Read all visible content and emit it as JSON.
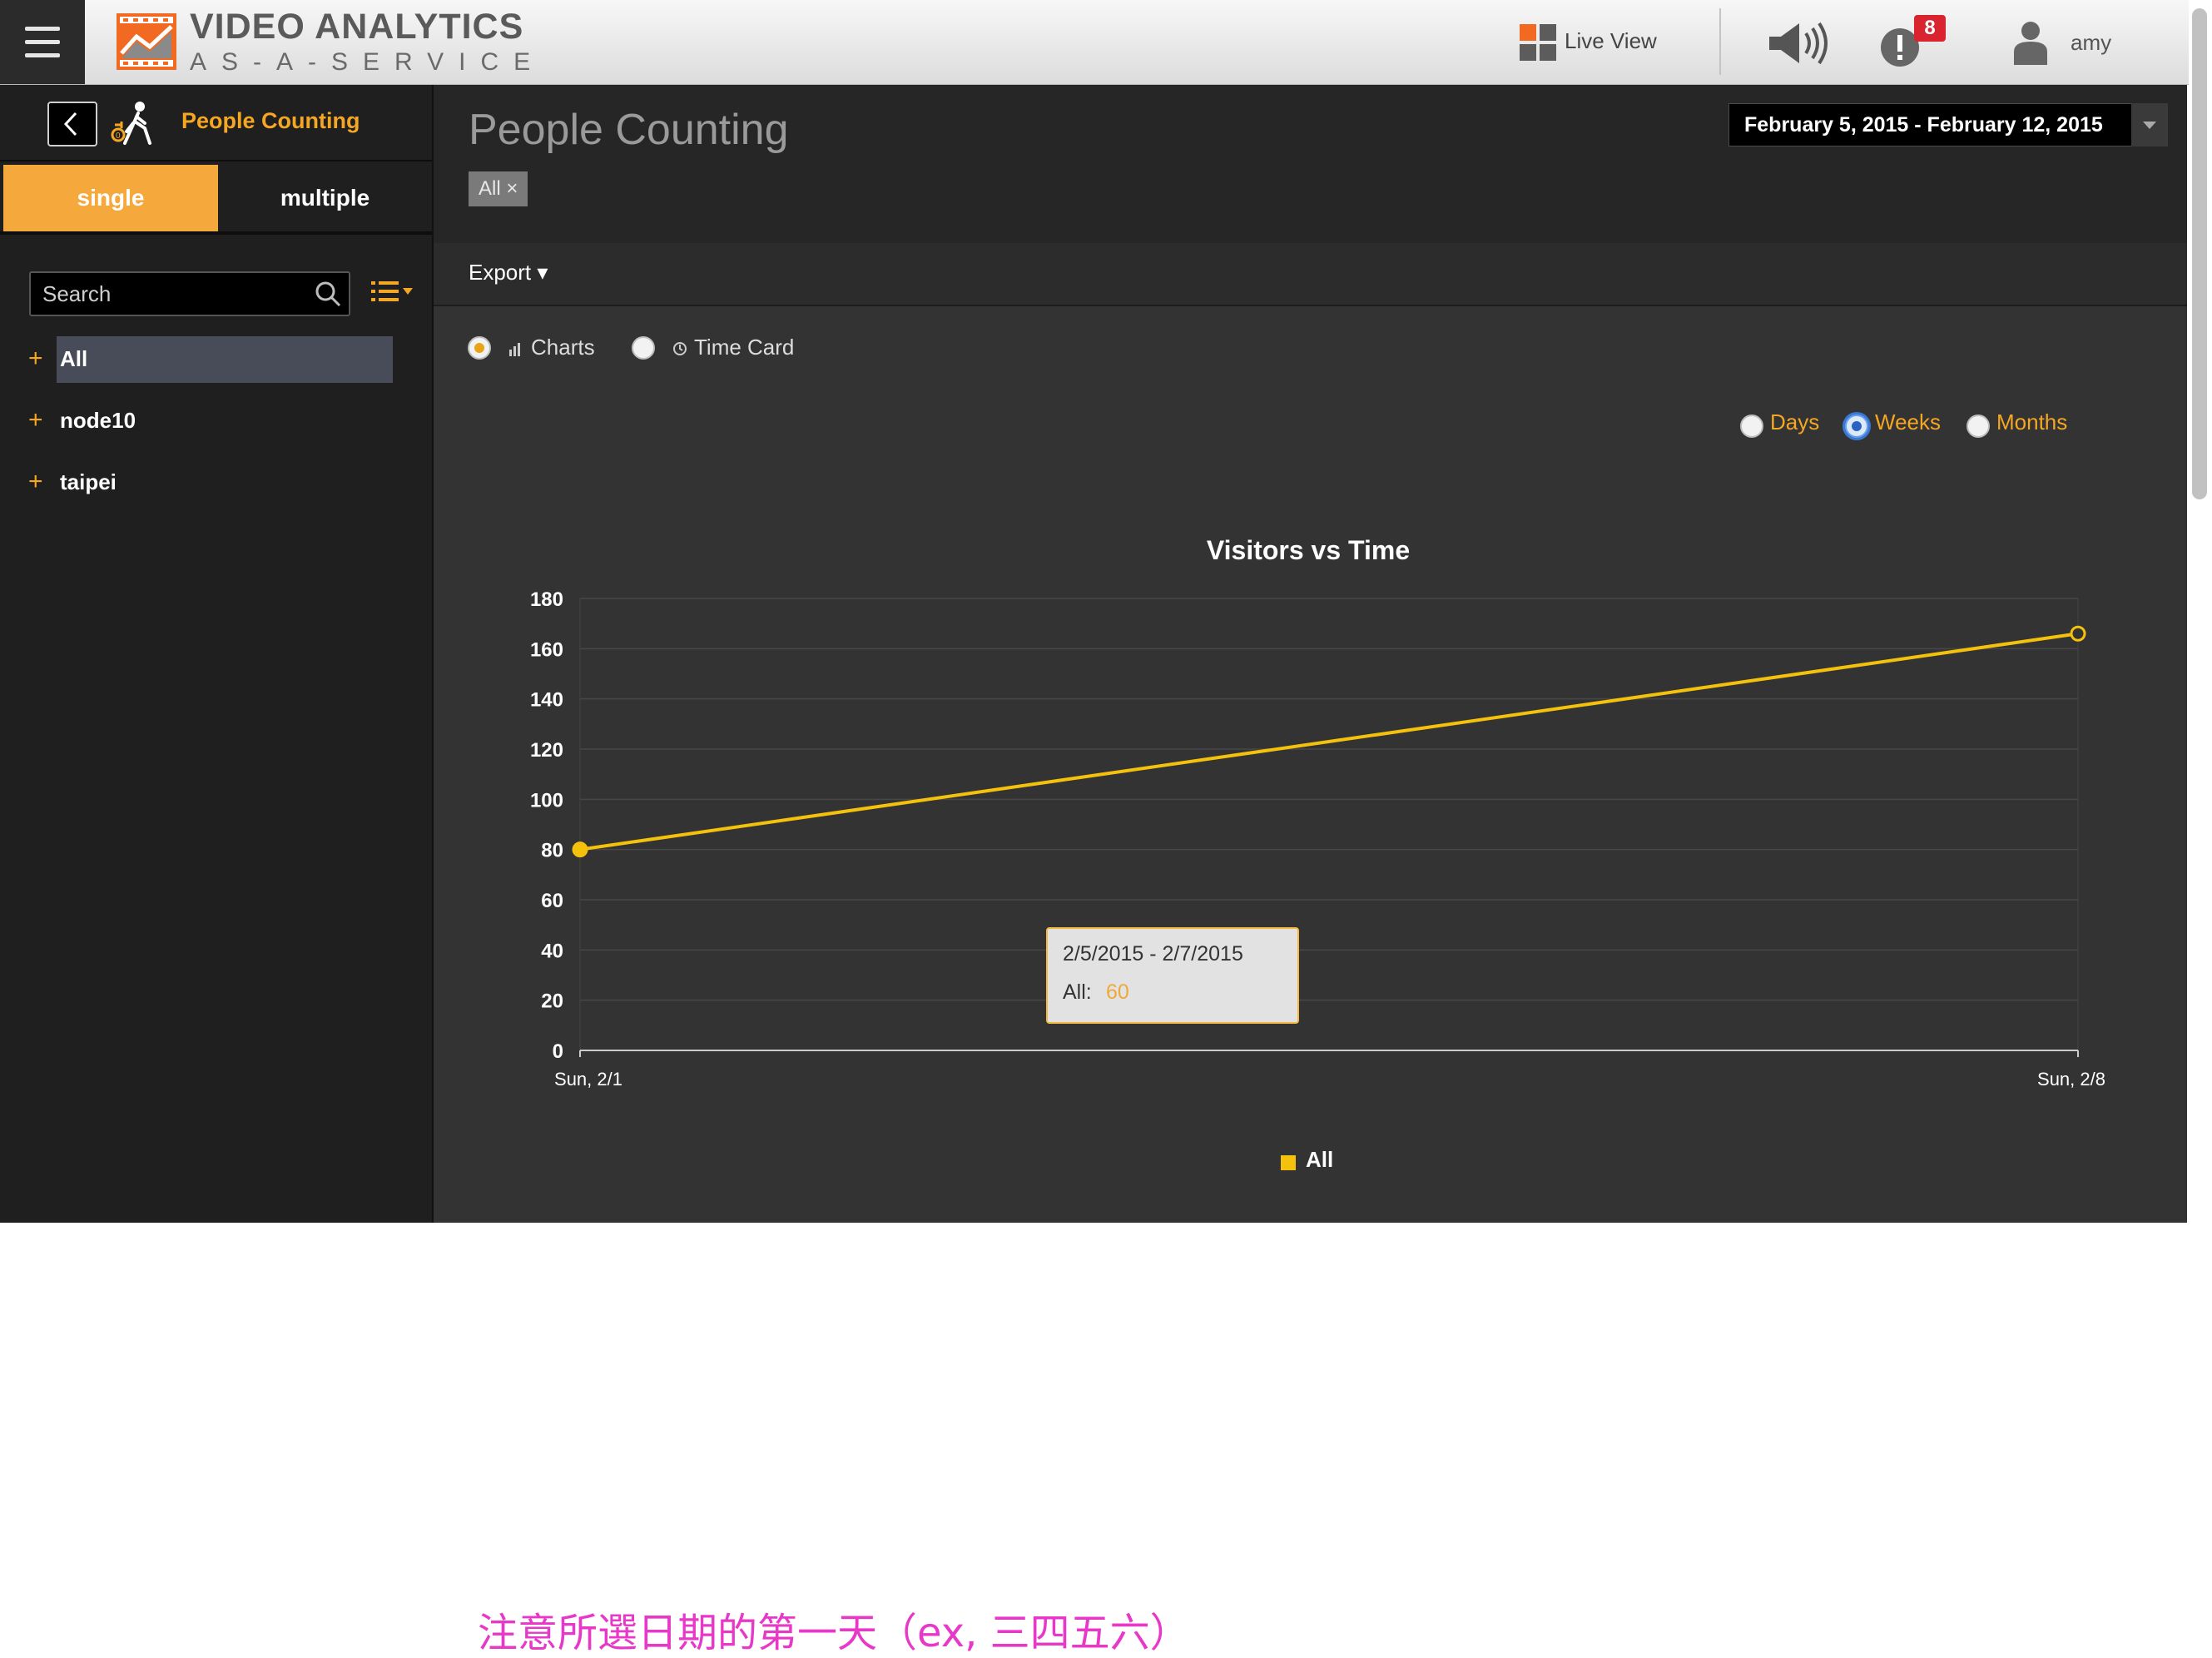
{
  "app": {
    "title_line1": "VIDEO ANALYTICS",
    "title_line2": "AS-A-SERVICE"
  },
  "topbar": {
    "live_view_label": "Live View",
    "alert_count": "8",
    "username": "amy",
    "colors": {
      "accent": "#f5a623",
      "alert": "#d9232e"
    },
    "icons": [
      "menu-icon",
      "grid-icon",
      "speaker-icon",
      "alert-icon",
      "user-icon"
    ]
  },
  "sidebar": {
    "title": "People Counting",
    "tabs": [
      {
        "label": "single",
        "active": true
      },
      {
        "label": "multiple",
        "active": false
      }
    ],
    "search": {
      "placeholder": "Search",
      "value": ""
    },
    "tree": [
      {
        "label": "All",
        "selected": true
      },
      {
        "label": "node10",
        "selected": false
      },
      {
        "label": "taipei",
        "selected": false
      }
    ]
  },
  "main": {
    "page_title": "People Counting",
    "filter_chip": "All ×",
    "date_range": "February 5, 2015 - February 12, 2015",
    "export_label": "Export ▾",
    "views": [
      {
        "label": "Charts",
        "selected": true
      },
      {
        "label": "Time Card",
        "selected": false
      }
    ],
    "granularity": [
      {
        "label": "Days",
        "selected": false
      },
      {
        "label": "Weeks",
        "selected": true
      },
      {
        "label": "Months",
        "selected": false
      }
    ],
    "tooltip": {
      "range": "2/5/2015 - 2/7/2015",
      "series": "All:",
      "value": "60"
    }
  },
  "chart_data": {
    "type": "line",
    "title": "Visitors vs Time",
    "xlabel": "",
    "ylabel": "",
    "x": [
      "Sun, 2/1",
      "Sun, 2/8"
    ],
    "series": [
      {
        "name": "All",
        "values": [
          80,
          166
        ],
        "color": "#f4c20d"
      }
    ],
    "ylim": [
      0,
      180
    ],
    "yticks": [
      0,
      20,
      40,
      60,
      80,
      100,
      120,
      140,
      160,
      180
    ],
    "grid": true,
    "legend": "bottom-center"
  },
  "note": "注意所選日期的第一天（ex, 三四五六）"
}
